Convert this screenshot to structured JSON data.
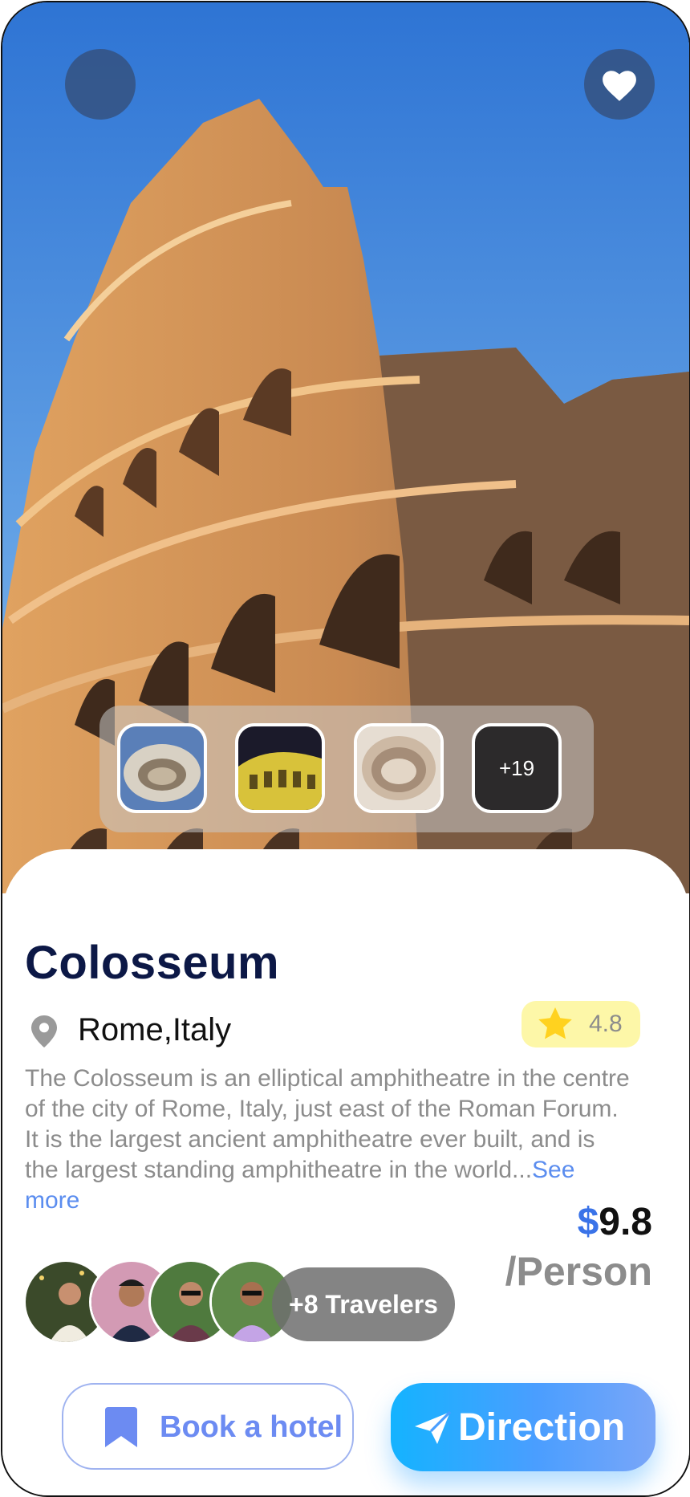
{
  "place": {
    "title": "Colosseum",
    "location": "Rome,Italy",
    "rating": "4.8",
    "description": "The Colosseum is an elliptical amphitheatre in the centre of the city of Rome, Italy, just east of the Roman Forum. It is the largest ancient amphitheatre ever built, and is the largest standing amphitheatre in the world...",
    "see_more": "See more"
  },
  "gallery": {
    "more_count": "+19"
  },
  "price": {
    "currency": "$",
    "amount": "9.8",
    "unit": "/Person"
  },
  "travelers": {
    "label": "+8 Travelers"
  },
  "actions": {
    "book_hotel": "Book a hotel",
    "direction": "Direction"
  },
  "icons": {
    "back": "back-icon",
    "favorite": "heart-icon",
    "location": "map-pin-icon",
    "rating": "star-icon",
    "bookmark": "bookmark-icon",
    "send": "paper-plane-icon"
  },
  "colors": {
    "title": "#0c1846",
    "accent": "#3a73e8",
    "rating_bg": "#fdf7a8",
    "direction_gradient_start": "#14b3ff",
    "direction_gradient_end": "#7aa6f8"
  }
}
